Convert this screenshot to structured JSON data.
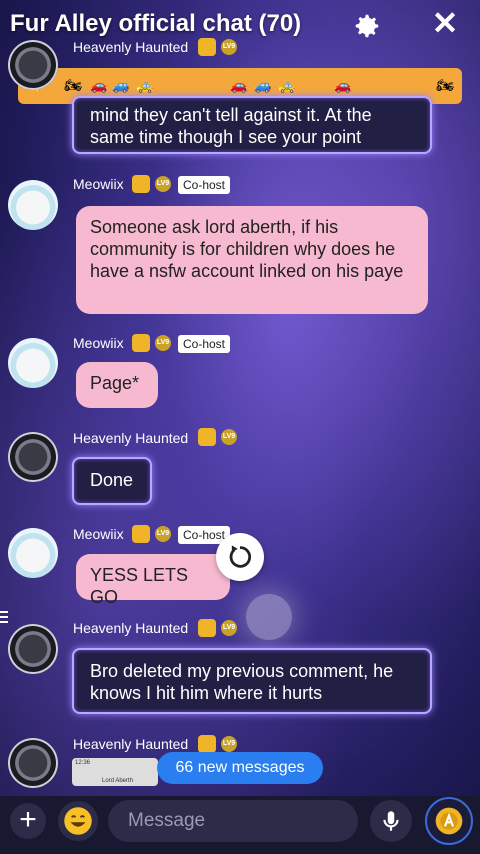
{
  "header": {
    "title": "Fur Alley official chat (70)",
    "settings_icon": "gear-icon",
    "close_icon": "close-icon"
  },
  "ticker": {
    "icon": "megaphone-icon",
    "items": [
      "motorcycle",
      "car-red",
      "car-blue",
      "car-white",
      "car-red",
      "car-blue",
      "car-white",
      "car-red",
      "motorcycle"
    ]
  },
  "messages": [
    {
      "user": "Heavenly Haunted",
      "role": "",
      "text": "mind they can't tell against it. At the same time though I see your point",
      "style": "dark"
    },
    {
      "user": "Meowiix",
      "role": "Co-host",
      "text": "Someone ask lord aberth, if his community is for children why does he have a nsfw account linked on his paye",
      "style": "pink"
    },
    {
      "user": "Meowiix",
      "role": "Co-host",
      "text": "Page*",
      "style": "pink"
    },
    {
      "user": "Heavenly Haunted",
      "role": "",
      "text": "Done",
      "style": "dark"
    },
    {
      "user": "Meowiix",
      "role": "Co-host",
      "text": "YESS LETS GO",
      "style": "pink"
    },
    {
      "user": "Heavenly Haunted",
      "role": "",
      "text": "Bro deleted my previous comment, he knows I hit him where it hurts",
      "style": "dark"
    },
    {
      "user": "Heavenly Haunted",
      "role": "",
      "text": "",
      "style": "dark"
    }
  ],
  "new_messages": {
    "count": "66",
    "label": "new messages"
  },
  "thumbnail": {
    "time": "12:36",
    "caption": "Lord Aberth"
  },
  "input": {
    "placeholder": "Message"
  },
  "colors": {
    "accent": "#2a7ef0",
    "pink_bubble": "#f7b9cf",
    "dark_bubble": "#221f45",
    "ticker": "#f4a73a"
  }
}
